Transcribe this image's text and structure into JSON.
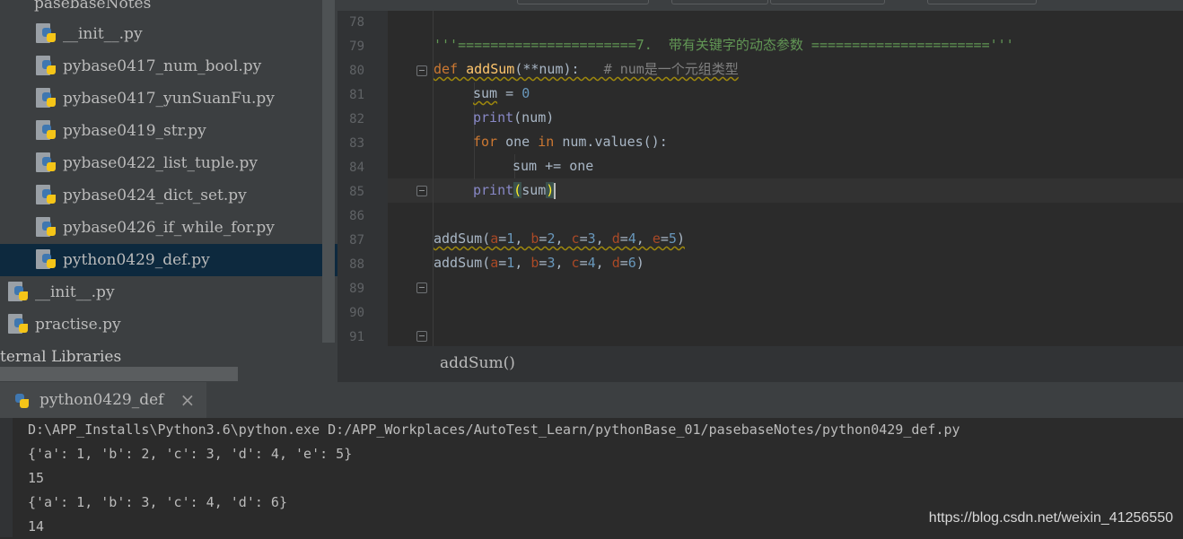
{
  "project_tree": {
    "folder_label": "pasebaseNotes",
    "items": [
      {
        "label": "__init__.py"
      },
      {
        "label": "pybase0417_num_bool.py"
      },
      {
        "label": "pybase0417_yunSuanFu.py"
      },
      {
        "label": "pybase0419_str.py"
      },
      {
        "label": "pybase0422_list_tuple.py"
      },
      {
        "label": "pybase0424_dict_set.py"
      },
      {
        "label": "pybase0426_if_while_for.py"
      },
      {
        "label": "python0429_def.py"
      }
    ],
    "root_items": [
      {
        "label": "__init__.py"
      },
      {
        "label": "practise.py"
      }
    ],
    "external_libraries": "ternal Libraries"
  },
  "editor": {
    "line_numbers": [
      "78",
      "79",
      "80",
      "81",
      "82",
      "83",
      "84",
      "85",
      "86",
      "87",
      "88",
      "89",
      "90",
      "91"
    ],
    "code": {
      "l79": "'''======================7.  带有关键字的动态参数 ======================'''",
      "l80_def": "def ",
      "l80_name": "addSum",
      "l80_params": "(**num):   ",
      "l80_comment": "# num是一个元组类型",
      "l81_var": "sum",
      "l81_op": " = ",
      "l81_num": "0",
      "l82_fn": "print",
      "l82_args": "(num)",
      "l83_for": "for",
      "l83_mid": " one ",
      "l83_in": "in",
      "l83_rest": " num.values():",
      "l84": "sum += one",
      "l85_fn": "print",
      "l85_open": "(",
      "l85_arg": "sum",
      "l85_close": ")",
      "call1": {
        "name": "addSum",
        "args": [
          {
            "k": "a",
            "v": "1"
          },
          {
            "k": "b",
            "v": "2"
          },
          {
            "k": "c",
            "v": "3"
          },
          {
            "k": "d",
            "v": "4"
          },
          {
            "k": "e",
            "v": "5"
          }
        ]
      },
      "call2": {
        "name": "addSum",
        "args": [
          {
            "k": "a",
            "v": "1"
          },
          {
            "k": "b",
            "v": "3"
          },
          {
            "k": "c",
            "v": "4"
          },
          {
            "k": "d",
            "v": "6"
          }
        ]
      }
    },
    "breadcrumb": "addSum()"
  },
  "run_panel": {
    "tab_label": "python0429_def",
    "close_glyph": "×",
    "output": [
      "D:\\APP_Installs\\Python3.6\\python.exe D:/APP_Workplaces/AutoTest_Learn/pythonBase_01/pasebaseNotes/python0429_def.py",
      "{'a': 1, 'b': 2, 'c': 3, 'd': 4, 'e': 5}",
      "15",
      "{'a': 1, 'b': 3, 'c': 4, 'd': 6}",
      "14"
    ]
  },
  "watermark": "https://blog.csdn.net/weixin_41256550",
  "colors": {
    "keyword": "#cc7832",
    "function": "#ffc66d",
    "number": "#6897bb",
    "string": "#629755",
    "comment": "#808080",
    "param": "#aa4926",
    "selection": "#0d293e"
  }
}
